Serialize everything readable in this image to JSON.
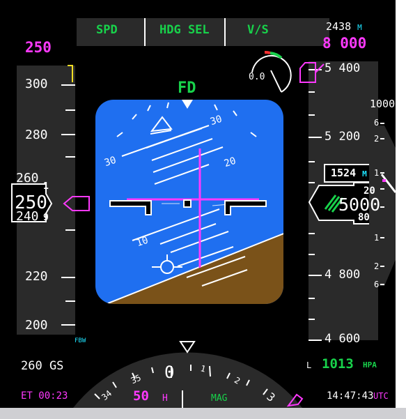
{
  "fma": {
    "speed_mode": "SPD",
    "lateral_mode": "HDG SEL",
    "vertical_mode": "V/S"
  },
  "speed": {
    "selected": "250",
    "current": "250",
    "current_upper": "1",
    "current_lower": "9",
    "tape_labels": [
      "300",
      "280",
      "260",
      "240",
      "220",
      "200"
    ],
    "ground_speed": "260 GS"
  },
  "attitude": {
    "fd_label": "FD",
    "pitch_labels": [
      "30",
      "30",
      "20",
      "10"
    ],
    "fbw_label": "FBW"
  },
  "altitude": {
    "selected_meters": "2438",
    "selected_meters_unit": "M",
    "selected_feet": "8 000",
    "tape_labels": [
      "5 400",
      "5 200",
      "4 800",
      "4 600"
    ],
    "meters_readout": "1524",
    "meters_unit": "M",
    "current_feet": "5000",
    "roller_upper": "20",
    "roller_lower": "80",
    "baro_side": "L",
    "baro_value": "1013",
    "baro_unit": "HPA"
  },
  "radio": {
    "value": "0.0"
  },
  "vsi": {
    "top_label": "1000",
    "scale_labels": [
      "6",
      "2",
      "1",
      "1",
      "2",
      "6"
    ]
  },
  "heading": {
    "selected": "50",
    "selected_suffix": "H",
    "reference": "MAG",
    "compass_labels": [
      "34",
      "35",
      "0",
      "1",
      "2",
      "3"
    ]
  },
  "clock": {
    "elapsed": "ET 00:23",
    "time": "14:47:43",
    "time_zone": "UTC"
  },
  "colors": {
    "magenta": "#ff39ff",
    "green": "#18d24b",
    "cyan": "#1ee3ff",
    "sky": "#1f6ff0",
    "ground": "#7a5219",
    "yellow": "#f2de24"
  }
}
